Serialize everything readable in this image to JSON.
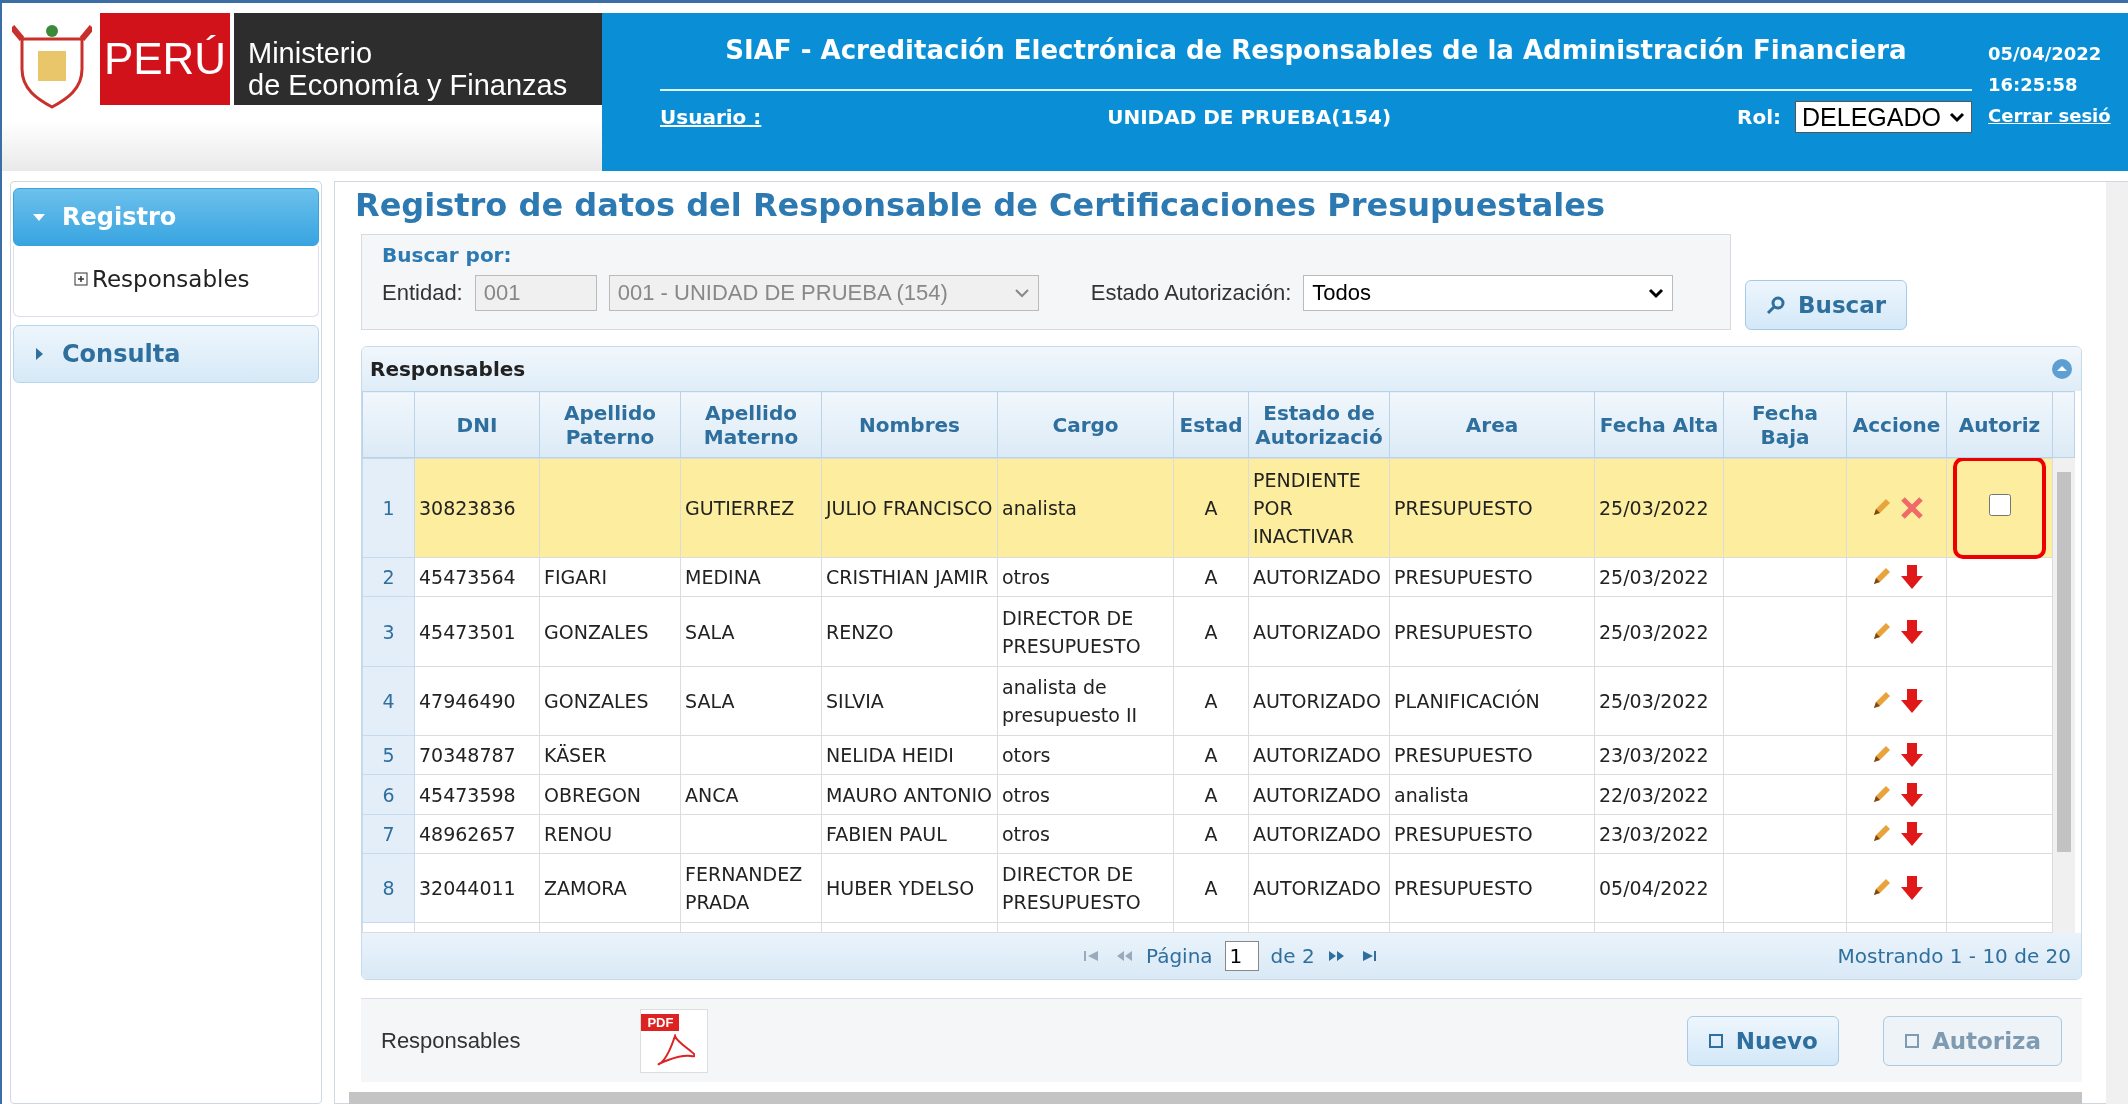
{
  "header": {
    "country": "PERÚ",
    "ministry_line1": "Ministerio",
    "ministry_line2": "de Economía y Finanzas",
    "title": "SIAF - Acreditación Electrónica de Responsables de la Administración Financiera",
    "user_label": "Usuario :",
    "user_value": "UNIDAD DE PRUEBA(154)",
    "role_label": "Rol:",
    "role_value": "DELEGADO",
    "date": "05/04/2022",
    "time": "16:25:58",
    "logout": "Cerrar sesió"
  },
  "sidebar": {
    "items": [
      {
        "label": "Registro",
        "expanded": true,
        "selected": true,
        "children": [
          {
            "label": "Responsables"
          }
        ]
      },
      {
        "label": "Consulta",
        "expanded": false,
        "selected": false
      }
    ]
  },
  "page_title": "Registro de datos del Responsable de Certificaciones Presupuestales",
  "search": {
    "legend": "Buscar por:",
    "entity_label": "Entidad:",
    "entity_code": "001",
    "entity_name": "001 - UNIDAD DE PRUEBA (154)",
    "status_label": "Estado Autorización:",
    "status_value": "Todos",
    "button": "Buscar"
  },
  "table": {
    "title": "Responsables",
    "columns": [
      "DNI",
      "Apellido Paterno",
      "Apellido Materno",
      "Nombres",
      "Cargo",
      "Estad",
      "Estado de Autorizació",
      "Area",
      "Fecha Alta",
      "Fecha Baja",
      "Accione",
      "Autoriz"
    ],
    "rows": [
      {
        "n": "1",
        "cells": [
          "30823836",
          "",
          "GUTIERREZ",
          "JULIO FRANCISCO",
          "analista",
          "A",
          "PENDIENTE POR INACTIVAR",
          "PRESUPUESTO",
          "25/03/2022",
          ""
        ],
        "selected": true,
        "kind": "cross",
        "authorize": {
          "checked": false,
          "highlighted": true
        }
      },
      {
        "n": "2",
        "cells": [
          "45473564",
          "FIGARI",
          "MEDINA",
          "CRISTHIAN JAMIR",
          "otros",
          "A",
          "AUTORIZADO",
          "PRESUPUESTO",
          "25/03/2022",
          ""
        ],
        "selected": false,
        "kind": "arrow"
      },
      {
        "n": "3",
        "cells": [
          "45473501",
          "GONZALES",
          "SALA",
          "RENZO",
          "DIRECTOR DE PRESUPUESTO",
          "A",
          "AUTORIZADO",
          "PRESUPUESTO",
          "25/03/2022",
          ""
        ],
        "selected": false,
        "kind": "arrow"
      },
      {
        "n": "4",
        "cells": [
          "47946490",
          "GONZALES",
          "SALA",
          "SILVIA",
          "analista de presupuesto II",
          "A",
          "AUTORIZADO",
          "PLANIFICACIÓN",
          "25/03/2022",
          ""
        ],
        "selected": false,
        "kind": "arrow"
      },
      {
        "n": "5",
        "cells": [
          "70348787",
          "KÄSER",
          "",
          "NELIDA HEIDI",
          "otors",
          "A",
          "AUTORIZADO",
          "PRESUPUESTO",
          "23/03/2022",
          ""
        ],
        "selected": false,
        "kind": "arrow"
      },
      {
        "n": "6",
        "cells": [
          "45473598",
          "OBREGON",
          "ANCA",
          "MAURO ANTONIO",
          "otros",
          "A",
          "AUTORIZADO",
          "analista",
          "22/03/2022",
          ""
        ],
        "selected": false,
        "kind": "arrow"
      },
      {
        "n": "7",
        "cells": [
          "48962657",
          "RENOU",
          "",
          "FABIEN PAUL",
          "otros",
          "A",
          "AUTORIZADO",
          "PRESUPUESTO",
          "23/03/2022",
          ""
        ],
        "selected": false,
        "kind": "arrow"
      },
      {
        "n": "8",
        "cells": [
          "32044011",
          "ZAMORA",
          "FERNANDEZ PRADA",
          "HUBER YDELSO",
          "DIRECTOR DE PRESUPUESTO",
          "A",
          "AUTORIZADO",
          "PRESUPUESTO",
          "05/04/2022",
          ""
        ],
        "selected": false,
        "kind": "arrow"
      }
    ],
    "pager": {
      "page_label": "Página",
      "page": "1",
      "of": "de 2",
      "summary": "Mostrando 1 - 10 de 20"
    }
  },
  "footer": {
    "label": "Responsables",
    "pdf_text": "PDF",
    "buttons": [
      {
        "label": "Nuevo",
        "disabled": false
      },
      {
        "label": "Autoriza",
        "disabled": true
      }
    ]
  }
}
